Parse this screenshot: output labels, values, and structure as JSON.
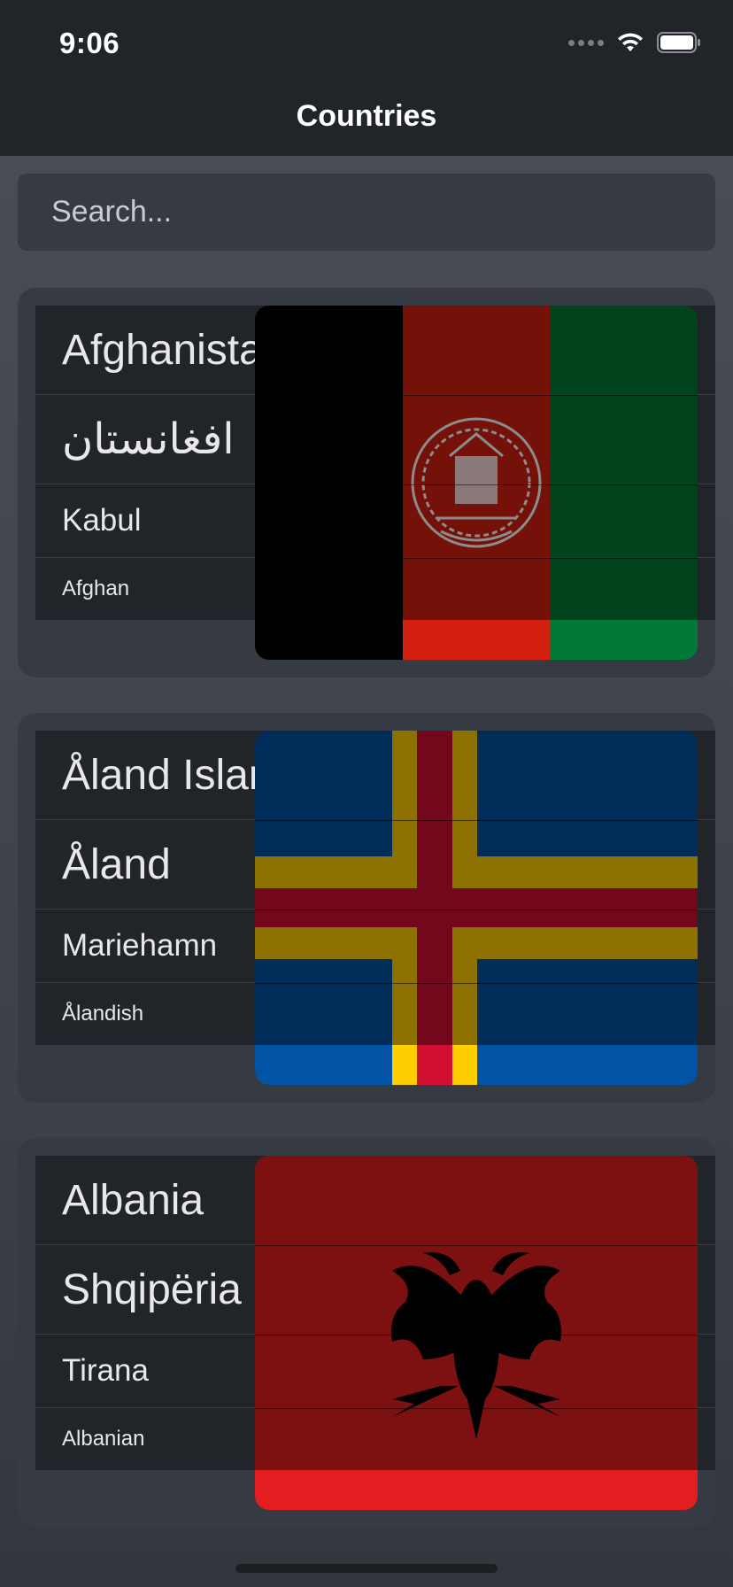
{
  "status_bar": {
    "time": "9:06"
  },
  "nav": {
    "title": "Countries"
  },
  "search": {
    "placeholder": "Search..."
  },
  "countries": [
    {
      "name": "Afghanistan",
      "native_name": "افغانستان",
      "capital": "Kabul",
      "demonym": "Afghan",
      "flag": "afghanistan-flag"
    },
    {
      "name": "Åland Islands",
      "native_name": "Åland",
      "capital": "Mariehamn",
      "demonym": "Ålandish",
      "flag": "aland-flag"
    },
    {
      "name": "Albania",
      "native_name": "Shqipëria",
      "capital": "Tirana",
      "demonym": "Albanian",
      "flag": "albania-flag"
    }
  ],
  "colors": {
    "background": "#464a52",
    "bar": "#212429",
    "card": "#363a42",
    "text": "#e8e8ea"
  }
}
